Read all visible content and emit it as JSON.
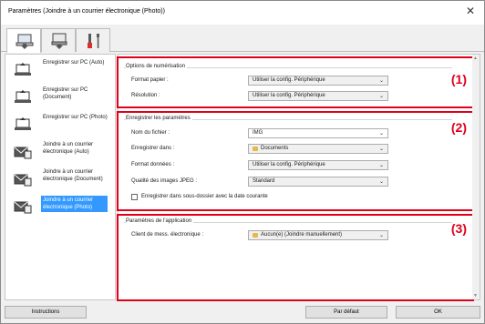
{
  "window": {
    "title": "Paramètres (Joindre à un courrier électronique (Photo))"
  },
  "tabs": [
    {
      "name": "scan-from-computer",
      "icon": "computer-icon"
    },
    {
      "name": "scan-from-panel",
      "icon": "scanner-panel-icon"
    },
    {
      "name": "general-settings",
      "icon": "tools-icon"
    }
  ],
  "sidebar": {
    "items": [
      {
        "label": "Enregistrer sur PC (Auto)",
        "icon": "pc-save-icon"
      },
      {
        "label": "Enregistrer sur PC (Document)",
        "icon": "pc-save-icon"
      },
      {
        "label": "Enregistrer sur PC (Photo)",
        "icon": "pc-save-icon"
      },
      {
        "label": "Joindre à un courrier électronique (Auto)",
        "icon": "mail-icon"
      },
      {
        "label": "Joindre à un courrier électronique (Document)",
        "icon": "mail-icon"
      },
      {
        "label": "Joindre à un courrier électronique (Photo)",
        "icon": "mail-icon"
      }
    ]
  },
  "sections": {
    "scan_options": {
      "number": "(1)",
      "title": "Options de numérisation",
      "paper_size_label": "Format papier :",
      "paper_size_value": "Utiliser la config. Périphérique",
      "resolution_label": "Résolution :",
      "resolution_value": "Utiliser la config. Périphérique"
    },
    "save_settings": {
      "number": "(2)",
      "title": "Enregistrer les paramètres",
      "filename_label": "Nom du fichier :",
      "filename_value": "IMG",
      "save_in_label": "Enregistrer dans :",
      "save_in_value": "Documents",
      "data_format_label": "Format données :",
      "data_format_value": "Utiliser la config. Périphérique",
      "jpeg_quality_label": "Qualité des images JPEG :",
      "jpeg_quality_value": "Standard",
      "subfolder_label": "Enregistrer dans sous-dossier avec la date courante",
      "subfolder_checked": false
    },
    "app_settings": {
      "number": "(3)",
      "title": "Paramètres de l'application",
      "email_client_label": "Client de mess. électronique :",
      "email_client_value": "Aucun(e) (Joindre manuellement)"
    }
  },
  "footer": {
    "instructions_label": "Instructions",
    "defaults_label": "Par défaut",
    "ok_label": "OK"
  },
  "colors": {
    "highlight": "#e0001a",
    "selection": "#3399ff"
  }
}
